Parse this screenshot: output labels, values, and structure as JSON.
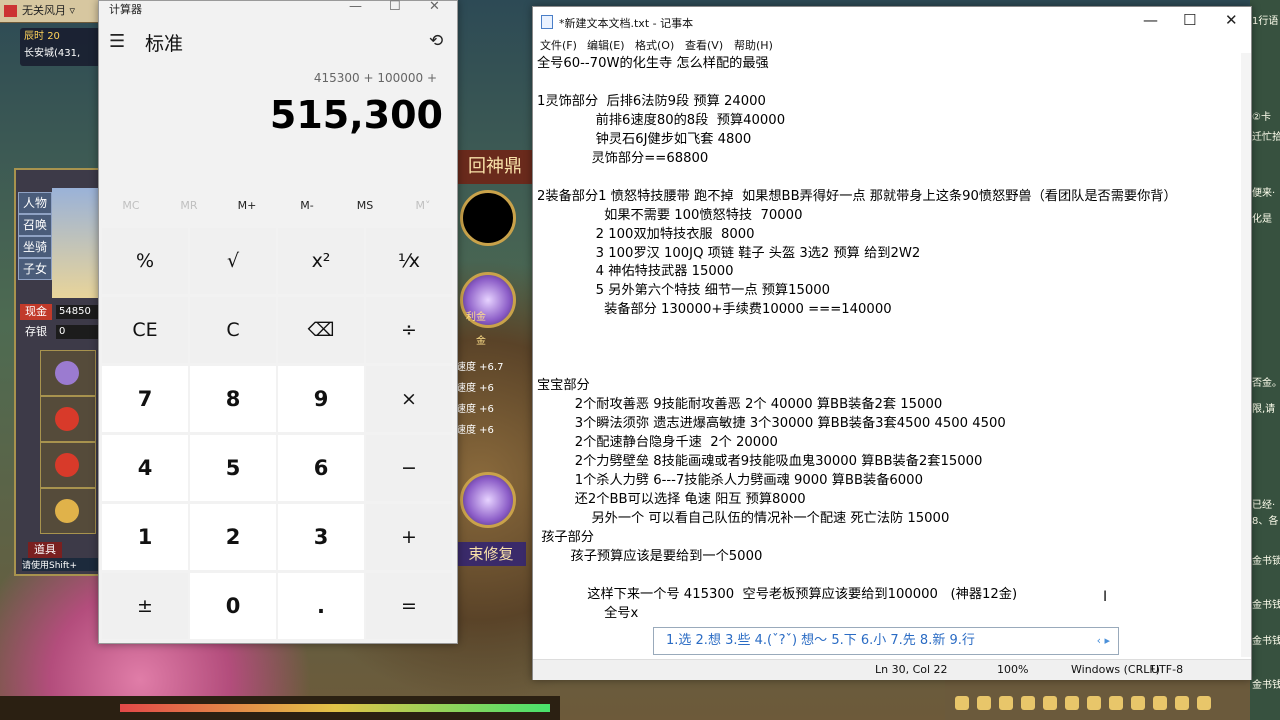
{
  "game": {
    "window_title": "无关风月 ▿",
    "time_label": "辰时",
    "time_value": "20",
    "location": "长安城(431,",
    "side_menu": [
      "人物",
      "召唤",
      "坐骑",
      "子女"
    ],
    "cash_label": "现金",
    "cash_value": "54850",
    "savings_label": "存银",
    "savings_value": "0",
    "item_tab": "道具",
    "hint": "请使用Shift+",
    "title_banner": "回神鼎",
    "orb_label": "利金",
    "gold_label": "金",
    "buffs": [
      "速度 +6.7",
      "速度 +6",
      "速度 +6",
      "速度 +6"
    ],
    "repair_button": "束修复"
  },
  "calculator": {
    "title": "计算器",
    "mode": "标准",
    "expression": "415300 + 100000 +",
    "display": "515,300",
    "memory": [
      "MC",
      "MR",
      "M+",
      "M-",
      "MS",
      "M˅"
    ],
    "keys": [
      [
        "%",
        "√",
        "x²",
        "⅟x"
      ],
      [
        "CE",
        "C",
        "⌫",
        "÷"
      ],
      [
        "7",
        "8",
        "9",
        "×"
      ],
      [
        "4",
        "5",
        "6",
        "−"
      ],
      [
        "1",
        "2",
        "3",
        "+"
      ],
      [
        "±",
        "0",
        ".",
        "="
      ]
    ]
  },
  "notepad": {
    "title": "*新建文本文档.txt - 记事本",
    "menus": [
      "文件(F)",
      "编辑(E)",
      "格式(O)",
      "查看(V)",
      "帮助(H)"
    ],
    "lines": [
      "全号60--70W的化生寺 怎么样配的最强",
      "",
      "1灵饰部分  后排6法防9段 预算 24000",
      "              前排6速度80的8段  预算40000",
      "              钟灵石6J健步如飞套 4800",
      "             灵饰部分==68800",
      "",
      "2装备部分1 愤怒特技腰带 跑不掉  如果想BB弄得好一点 那就带身上这条90愤怒野兽（看团队是否需要你背）",
      "                如果不需要 100愤怒特技  70000",
      "              2 100双加特技衣服  8000",
      "              3 100罗汉 100JQ 项链 鞋子 头盔 3选2 预算 给到2W2",
      "              4 神佑特技武器 15000",
      "              5 另外第六个特技 细节一点 预算15000",
      "                装备部分 130000+手续费10000 ===140000",
      "",
      "",
      "",
      "宝宝部分",
      "         2个耐攻善恶 9技能耐攻善恶 2个 40000 算BB装备2套 15000",
      "         3个瞬法须弥 遗志进爆高敏捷 3个30000 算BB装备3套4500 4500 4500",
      "         2个配速静台隐身千速  2个 20000",
      "         2个力劈壁垒 8技能画魂或者9技能吸血鬼30000 算BB装备2套15000",
      "         1个杀人力劈 6---7技能杀人力劈画魂 9000 算BB装备6000",
      "         还2个BB可以选择 龟速 阳互 预算8000",
      "             另外一个 可以看自己队伍的情况补一个配速 死亡法防 15000",
      " 孩子部分",
      "        孩子预算应该是要给到一个5000",
      "",
      "            这样下来一个号 415300  空号老板预算应该要给到100000   (神器12金)",
      "                全号x"
    ],
    "ime_candidates": "1.选 2.想 3.些 4.(ˇ?ˇ) 想～ 5.下 6.小 7.先 8.新 9.行",
    "status": {
      "position": "Ln 30, Col 22",
      "zoom": "100%",
      "line_ending": "Windows (CRLF)",
      "encoding": "UTF-8"
    }
  },
  "right_strip": [
    "1行语",
    "②卡",
    "迁忙拾",
    "便来·",
    "化是",
    "否金。",
    "限,请",
    "已经·",
    "8、各",
    "金书锁",
    "金书钱",
    "金书钱",
    "金书钱"
  ]
}
